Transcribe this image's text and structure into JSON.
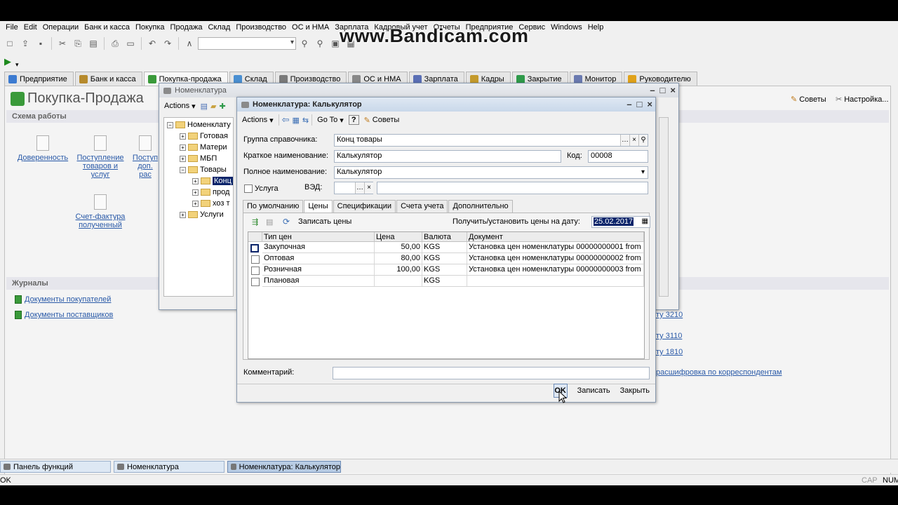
{
  "menubar": [
    "File",
    "Edit",
    "Операции",
    "Банк и касса",
    "Покупка",
    "Продажа",
    "Склад",
    "Производство",
    "ОС и НМА",
    "Зарплата",
    "Кадровый учет",
    "Отчеты",
    "Предприятие",
    "Сервис",
    "Windows",
    "Help"
  ],
  "watermark": "www.Bandicam.com",
  "section_tabs": [
    "Предприятие",
    "Банк и касса",
    "Покупка-продажа",
    "Склад",
    "Производство",
    "ОС и НМА",
    "Зарплата",
    "Кадры",
    "Закрытие",
    "Монитор",
    "Руководителю"
  ],
  "page": {
    "title": "Покупка-Продажа",
    "scheme_header": "Схема работы",
    "scheme_items": [
      "Доверенность",
      "Поступление товаров и услуг",
      "Поступ доп. рас",
      "Счет-фактура полученный"
    ],
    "journals_header": "Журналы",
    "journals": [
      "Документы покупателей",
      "Документы поставщиков"
    ],
    "right_links": [
      "ту 3210",
      "ту 3110",
      "ту 1810",
      "расшифровка по корреспондентам"
    ],
    "tips": "Советы",
    "settings": "Настройка..."
  },
  "nomenclature_window": {
    "title": "Номенклатура",
    "actions": "Actions",
    "tree": [
      "Номенклату",
      "Готовая",
      "Матери",
      "МБП",
      "Товары",
      "Конц",
      "прод",
      "хоз т",
      "Услуги"
    ]
  },
  "item_window": {
    "title": "Номенклатура: Калькулятор",
    "toolbar": {
      "actions": "Actions",
      "goto": "Go To",
      "help": "?",
      "tips": "Советы"
    },
    "fields": {
      "group_label": "Группа справочника:",
      "group_value": "Конц товары",
      "short_name_label": "Краткое наименование:",
      "short_name_value": "Калькулятор",
      "code_label": "Код:",
      "code_value": "00008",
      "full_name_label": "Полное наименование:",
      "full_name_value": "Калькулятор",
      "service_label": "Услуга",
      "ved_label": "ВЭД:",
      "comment_label": "Комментарий:"
    },
    "tabs": [
      "По умолчанию",
      "Цены",
      "Спецификации",
      "Счета учета",
      "Дополнительно"
    ],
    "active_tab": "Цены",
    "prices": {
      "write_label": "Записать цены",
      "date_label": "Получить/установить цены на дату:",
      "date_value": "25.02.2017",
      "columns": [
        "Тип цен",
        "Цена",
        "Валюта",
        "Документ"
      ],
      "rows": [
        {
          "type": "Закупочная",
          "price": "50,00",
          "currency": "KGS",
          "document": "Установка цен номенклатуры 00000000001 from ..."
        },
        {
          "type": "Оптовая",
          "price": "80,00",
          "currency": "KGS",
          "document": "Установка цен номенклатуры 00000000002 from ..."
        },
        {
          "type": "Розничная",
          "price": "100,00",
          "currency": "KGS",
          "document": "Установка цен номенклатуры 00000000003 from ..."
        },
        {
          "type": "Плановая",
          "price": "",
          "currency": "KGS",
          "document": ""
        }
      ]
    },
    "buttons": {
      "ok": "OK",
      "save": "Записать",
      "close": "Закрыть"
    }
  },
  "taskbar": [
    "Панель функций",
    "Номенклатура",
    "Номенклатура: Калькулятор"
  ],
  "status": {
    "left": "OK",
    "cap": "CAP",
    "num": "NUM"
  }
}
